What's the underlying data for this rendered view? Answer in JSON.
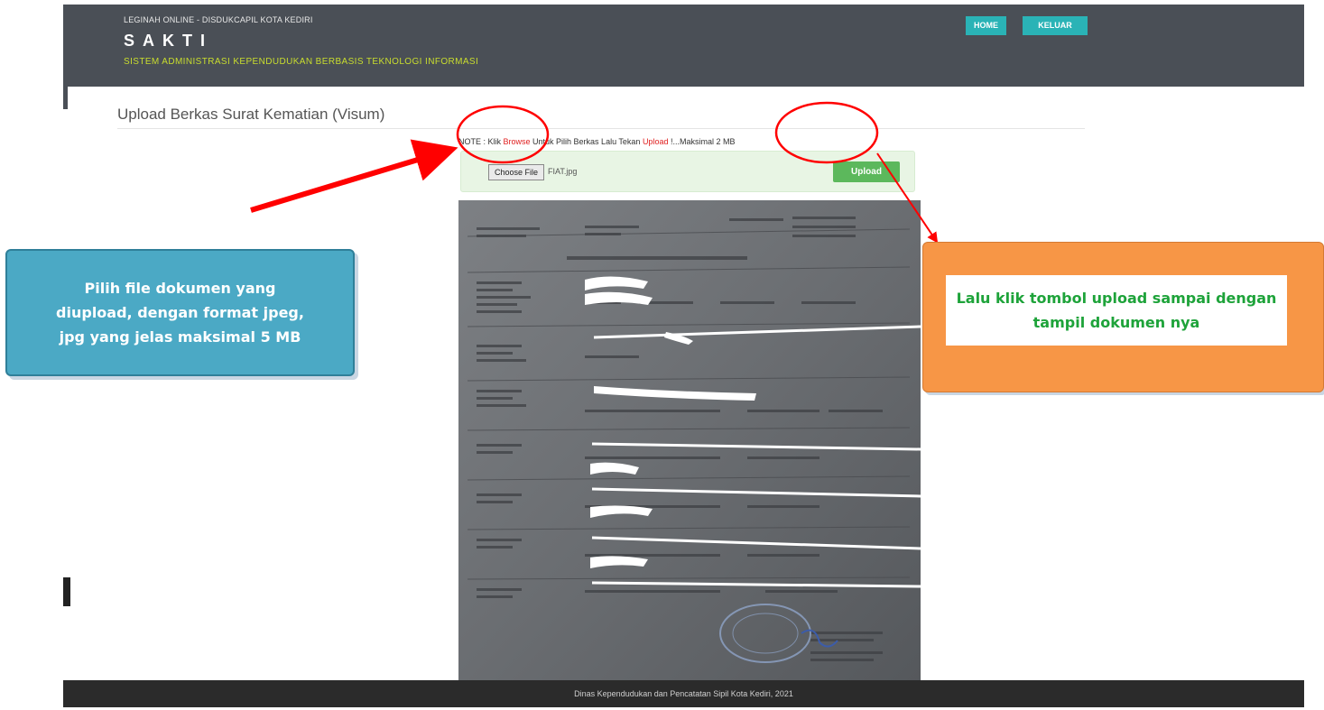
{
  "header": {
    "subtitle": "LEGINAH ONLINE - DISDUKCAPIL KOTA KEDIRI",
    "brand": "SAKTI",
    "tagline": "SISTEM ADMINISTRASI KEPENDUDUKAN BERBASIS TEKNOLOGI INFORMASI",
    "nav": {
      "home_label": "HOME",
      "keluar_label": "KELUAR"
    }
  },
  "page": {
    "title": "Upload Berkas Surat Kematian (Visum)"
  },
  "note": {
    "prefix": "NOTE : Klik ",
    "browse": "Browse",
    "middle": " Untuk Pilih Berkas Lalu Tekan ",
    "upload": "Upload",
    "suffix": " !...Maksimal 2 MB"
  },
  "upload_form": {
    "choose_label": "Choose File",
    "file_name": "FIAT.jpg",
    "upload_label": "Upload"
  },
  "footer": {
    "text": "Dinas Kependudukan dan Pencatatan Sipil Kota Kediri, 2021"
  },
  "callouts": {
    "left": "Pilih file dokumen yang diupload, dengan format jpeg, jpg yang jelas maksimal 5 MB",
    "right": "Lalu klik tombol upload sampai dengan tampil dokumen nya"
  },
  "colors": {
    "header_bg": "#4a4f56",
    "brand_accent": "#c9dd2e",
    "nav_button": "#2ab3b6",
    "upload_button": "#5cb85c",
    "annotation_red": "#ff0000",
    "callout_blue": "#4ba9c5",
    "callout_orange": "#f79646",
    "callout_green_text": "#1ea33a"
  }
}
